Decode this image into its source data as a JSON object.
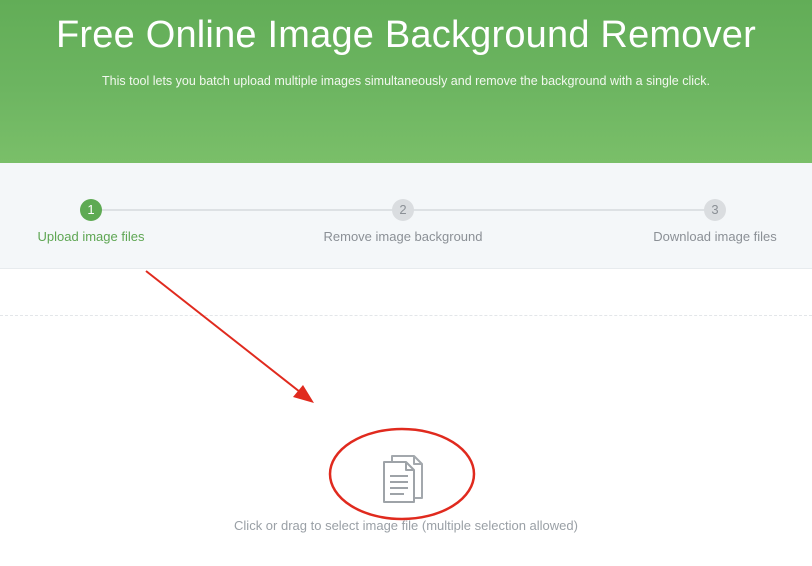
{
  "hero": {
    "title": "Free Online Image Background Remover",
    "subtitle": "This tool lets you batch upload multiple images simultaneously and remove the background with a single click."
  },
  "steps": [
    {
      "number": "1",
      "label": "Upload image files",
      "state": "active"
    },
    {
      "number": "2",
      "label": "Remove image background",
      "state": "inactive"
    },
    {
      "number": "3",
      "label": "Download image files",
      "state": "inactive"
    }
  ],
  "upload": {
    "icon": "document-icon",
    "hint": "Click or drag to select image file (multiple selection allowed)"
  },
  "colors": {
    "brand_green": "#62ad57",
    "active_step": "#5eaa53",
    "annotation_red": "#e02a1e"
  }
}
